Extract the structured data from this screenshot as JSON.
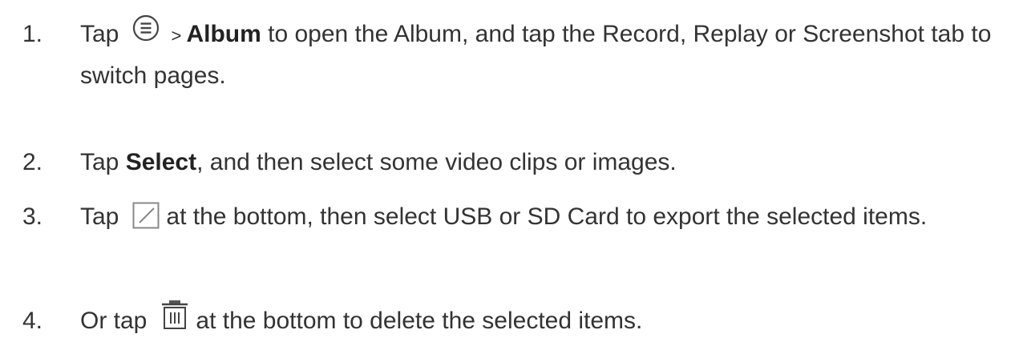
{
  "steps": [
    {
      "number": "1.",
      "before_icon": "Tap",
      "icon": "menu-circle-icon",
      "after_icon": " > ",
      "bold": "Album",
      "rest": " to open the Album, and tap the Record, Replay or Screenshot tab to switch pages."
    },
    {
      "number": "2.",
      "before_bold": "Tap ",
      "bold": "Select",
      "rest": ", and then select some video clips or images."
    },
    {
      "number": "3.",
      "before_icon": "Tap",
      "icon": "export-icon",
      "rest": " at the bottom, then select USB or SD Card to export the selected items."
    },
    {
      "number": "4.",
      "before_icon": "Or tap",
      "icon": "trash-icon",
      "rest": " at the bottom to delete the selected items."
    }
  ]
}
